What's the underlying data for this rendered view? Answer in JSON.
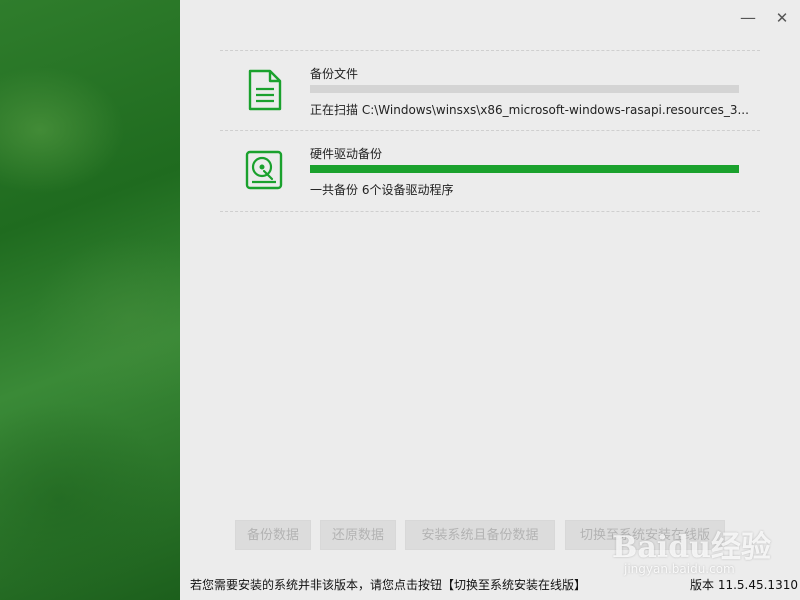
{
  "window": {
    "minimize_icon": "minimize-icon",
    "close_icon": "close-icon",
    "minimize_glyph": "—",
    "close_glyph": "✕"
  },
  "tasks": [
    {
      "icon": "document-icon",
      "title": "备份文件",
      "progress_fraction": 0.0,
      "status": "正在扫描 C:\\Windows\\winsxs\\x86_microsoft-windows-rasapi.resources_3..."
    },
    {
      "icon": "hard-drive-icon",
      "title": "硬件驱动备份",
      "progress_fraction": 1.0,
      "status": "一共备份 6个设备驱动程序"
    }
  ],
  "actions": {
    "backup_data": "备份数据",
    "restore_data": "还原数据",
    "install_and_backup": "安装系统且备份数据",
    "switch_online": "切换至系统安装在线版"
  },
  "footer": {
    "hint": "若您需要安装的系统并非该版本，请您点击按钮【切换至系统安装在线版】",
    "version": "版本 11.5.45.1310"
  },
  "watermark": {
    "brand": "Baidu经验",
    "url": "jingyan.baidu.com"
  },
  "colors": {
    "accent_green": "#1aa12d",
    "left_panel_green": "#2a7a2a"
  }
}
